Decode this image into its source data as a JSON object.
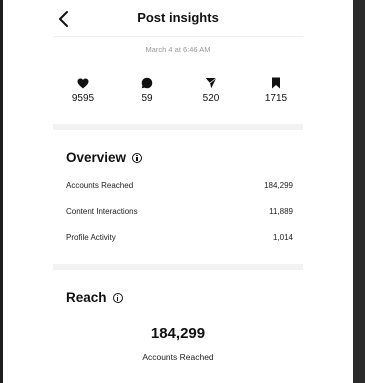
{
  "header": {
    "title": "Post insights"
  },
  "timestamp": "March 4 at 6:46 AM",
  "stats": [
    {
      "icon": "heart-icon",
      "value": "9595"
    },
    {
      "icon": "comment-icon",
      "value": "59"
    },
    {
      "icon": "share-icon",
      "value": "520"
    },
    {
      "icon": "bookmark-icon",
      "value": "1715"
    }
  ],
  "overview": {
    "title": "Overview",
    "rows": [
      {
        "label": "Accounts Reached",
        "value": "184,299"
      },
      {
        "label": "Content Interactions",
        "value": "11,889"
      },
      {
        "label": "Profile Activity",
        "value": "1,014"
      }
    ]
  },
  "reach": {
    "title": "Reach",
    "number": "184,299",
    "label": "Accounts Reached"
  }
}
